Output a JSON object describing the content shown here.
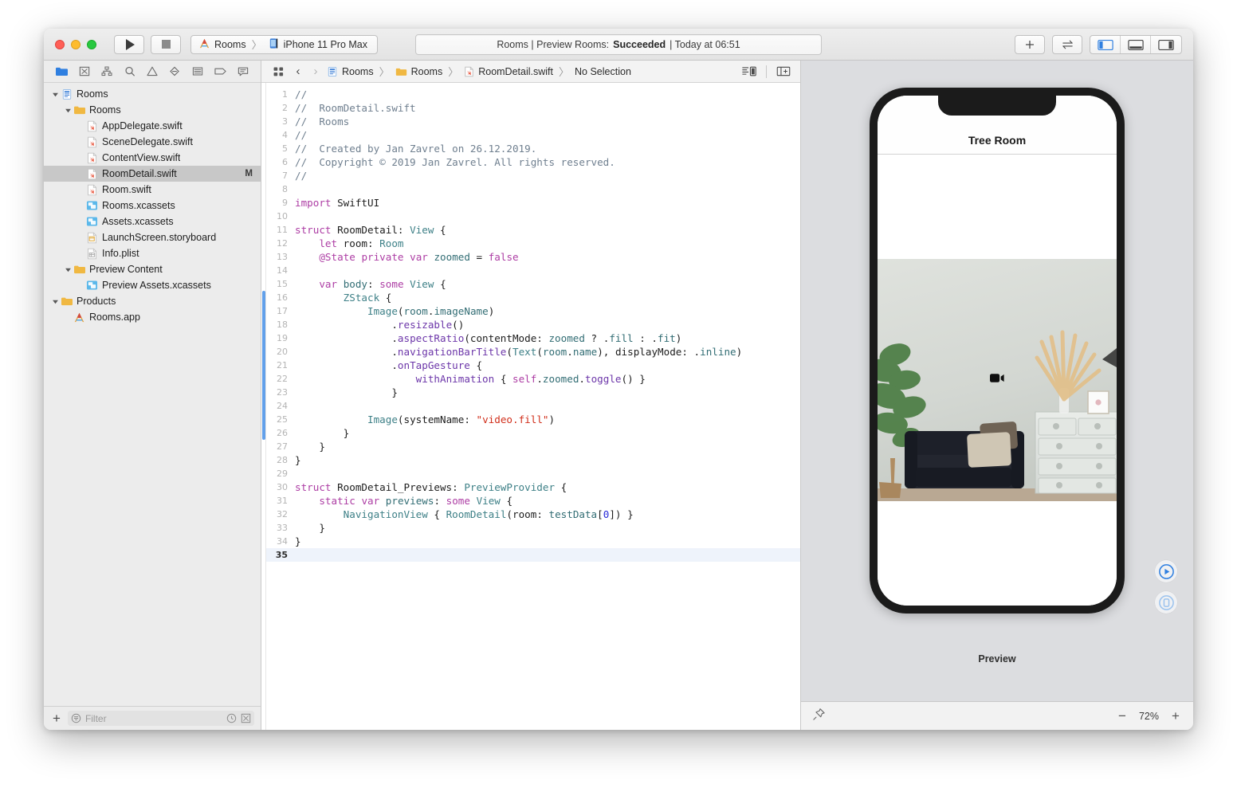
{
  "window": {
    "traffic_lights": [
      "close",
      "minimize",
      "zoom"
    ],
    "run_label": "Run",
    "stop_label": "Stop",
    "scheme": {
      "project": "Rooms",
      "separator": "〉",
      "destination": "iPhone 11 Pro Max"
    },
    "status": {
      "prefix": "Rooms | Preview Rooms:",
      "result": "Succeeded",
      "suffix": "| Today at 06:51"
    },
    "toolbar_right": [
      {
        "name": "add-button",
        "label": "+"
      },
      {
        "name": "swap-button",
        "label": "⇆"
      },
      {
        "name": "toggle-navigator-button",
        "label": "left-panel-icon"
      },
      {
        "name": "toggle-debug-area-button",
        "label": "bottom-panel-icon"
      },
      {
        "name": "toggle-inspector-button",
        "label": "right-panel-icon"
      }
    ]
  },
  "navigator": {
    "tabs": [
      {
        "name": "project-navigator-tab",
        "icon": "folder-icon",
        "active": true
      },
      {
        "name": "source-control-navigator-tab",
        "icon": "source-control-icon",
        "active": false
      },
      {
        "name": "symbol-navigator-tab",
        "icon": "hierarchy-icon",
        "active": false
      },
      {
        "name": "find-navigator-tab",
        "icon": "search-icon",
        "active": false
      },
      {
        "name": "issue-navigator-tab",
        "icon": "warning-icon",
        "active": false
      },
      {
        "name": "test-navigator-tab",
        "icon": "diamond-icon",
        "active": false
      },
      {
        "name": "debug-navigator-tab",
        "icon": "report-list-icon",
        "active": false
      },
      {
        "name": "breakpoint-navigator-tab",
        "icon": "tag-icon",
        "active": false
      },
      {
        "name": "report-navigator-tab",
        "icon": "speech-bubble-icon",
        "active": false
      }
    ],
    "tree": [
      {
        "label": "Rooms",
        "indent": 0,
        "icon": "project-icon",
        "twisty": "open",
        "selected": false,
        "badge": ""
      },
      {
        "label": "Rooms",
        "indent": 1,
        "icon": "folder-icon",
        "twisty": "open",
        "selected": false,
        "badge": ""
      },
      {
        "label": "AppDelegate.swift",
        "indent": 2,
        "icon": "swift-file-icon",
        "twisty": "none",
        "selected": false,
        "badge": ""
      },
      {
        "label": "SceneDelegate.swift",
        "indent": 2,
        "icon": "swift-file-icon",
        "twisty": "none",
        "selected": false,
        "badge": ""
      },
      {
        "label": "ContentView.swift",
        "indent": 2,
        "icon": "swift-file-icon",
        "twisty": "none",
        "selected": false,
        "badge": ""
      },
      {
        "label": "RoomDetail.swift",
        "indent": 2,
        "icon": "swift-file-icon",
        "twisty": "none",
        "selected": true,
        "badge": "M"
      },
      {
        "label": "Room.swift",
        "indent": 2,
        "icon": "swift-file-icon",
        "twisty": "none",
        "selected": false,
        "badge": ""
      },
      {
        "label": "Rooms.xcassets",
        "indent": 2,
        "icon": "assets-icon",
        "twisty": "none",
        "selected": false,
        "badge": ""
      },
      {
        "label": "Assets.xcassets",
        "indent": 2,
        "icon": "assets-icon",
        "twisty": "none",
        "selected": false,
        "badge": ""
      },
      {
        "label": "LaunchScreen.storyboard",
        "indent": 2,
        "icon": "storyboard-icon",
        "twisty": "none",
        "selected": false,
        "badge": ""
      },
      {
        "label": "Info.plist",
        "indent": 2,
        "icon": "plist-icon",
        "twisty": "none",
        "selected": false,
        "badge": ""
      },
      {
        "label": "Preview Content",
        "indent": 1,
        "icon": "folder-icon",
        "twisty": "open",
        "selected": false,
        "badge": ""
      },
      {
        "label": "Preview Assets.xcassets",
        "indent": 2,
        "icon": "assets-icon",
        "twisty": "none",
        "selected": false,
        "badge": ""
      },
      {
        "label": "Products",
        "indent": 0,
        "icon": "folder-icon",
        "twisty": "open",
        "selected": false,
        "badge": ""
      },
      {
        "label": "Rooms.app",
        "indent": 1,
        "icon": "app-icon",
        "twisty": "none",
        "selected": false,
        "badge": ""
      }
    ],
    "filter": {
      "add_label": "+",
      "placeholder": "Filter",
      "value": ""
    }
  },
  "editor": {
    "jumpbar": {
      "crumbs": [
        {
          "label": "Rooms",
          "icon": "project-icon"
        },
        {
          "label": "Rooms",
          "icon": "folder-icon"
        },
        {
          "label": "RoomDetail.swift",
          "icon": "swift-file-icon"
        },
        {
          "label": "No Selection",
          "icon": ""
        }
      ],
      "separator": "〉",
      "back_label": "‹",
      "forward_label": "›"
    },
    "current_line": 35,
    "change_bar": {
      "from_line": 16,
      "to_line": 26
    },
    "lines": [
      {
        "n": 1,
        "tokens": [
          [
            "cm",
            "//"
          ]
        ]
      },
      {
        "n": 2,
        "tokens": [
          [
            "cm",
            "//  RoomDetail.swift"
          ]
        ]
      },
      {
        "n": 3,
        "tokens": [
          [
            "cm",
            "//  Rooms"
          ]
        ]
      },
      {
        "n": 4,
        "tokens": [
          [
            "cm",
            "//"
          ]
        ]
      },
      {
        "n": 5,
        "tokens": [
          [
            "cm",
            "//  Created by Jan Zavrel on 26.12.2019."
          ]
        ]
      },
      {
        "n": 6,
        "tokens": [
          [
            "cm",
            "//  Copyright © 2019 Jan Zavrel. All rights reserved."
          ]
        ]
      },
      {
        "n": 7,
        "tokens": [
          [
            "cm",
            "//"
          ]
        ]
      },
      {
        "n": 8,
        "tokens": []
      },
      {
        "n": 9,
        "tokens": [
          [
            "kw",
            "import"
          ],
          [
            "pl",
            " SwiftUI"
          ]
        ]
      },
      {
        "n": 10,
        "tokens": []
      },
      {
        "n": 11,
        "tokens": [
          [
            "kw",
            "struct"
          ],
          [
            "pl",
            " RoomDetail: "
          ],
          [
            "ty",
            "View"
          ],
          [
            "pl",
            " {"
          ]
        ]
      },
      {
        "n": 12,
        "tokens": [
          [
            "pl",
            "    "
          ],
          [
            "kw",
            "let"
          ],
          [
            "pl",
            " room: "
          ],
          [
            "ty",
            "Room"
          ]
        ]
      },
      {
        "n": 13,
        "tokens": [
          [
            "pl",
            "    "
          ],
          [
            "kw",
            "@State"
          ],
          [
            "pl",
            " "
          ],
          [
            "kw",
            "private"
          ],
          [
            "pl",
            " "
          ],
          [
            "kw",
            "var"
          ],
          [
            "pl",
            " "
          ],
          [
            "pr",
            "zoomed"
          ],
          [
            "pl",
            " = "
          ],
          [
            "kw",
            "false"
          ]
        ]
      },
      {
        "n": 14,
        "tokens": []
      },
      {
        "n": 15,
        "tokens": [
          [
            "pl",
            "    "
          ],
          [
            "kw",
            "var"
          ],
          [
            "pl",
            " "
          ],
          [
            "pr",
            "body"
          ],
          [
            "pl",
            ": "
          ],
          [
            "kw",
            "some"
          ],
          [
            "pl",
            " "
          ],
          [
            "ty",
            "View"
          ],
          [
            "pl",
            " {"
          ]
        ]
      },
      {
        "n": 16,
        "tokens": [
          [
            "pl",
            "        "
          ],
          [
            "ty",
            "ZStack"
          ],
          [
            "pl",
            " {"
          ]
        ]
      },
      {
        "n": 17,
        "tokens": [
          [
            "pl",
            "            "
          ],
          [
            "ty",
            "Image"
          ],
          [
            "pl",
            "("
          ],
          [
            "pr",
            "room"
          ],
          [
            "pl",
            "."
          ],
          [
            "pr",
            "imageName"
          ],
          [
            "pl",
            ")"
          ]
        ]
      },
      {
        "n": 18,
        "tokens": [
          [
            "pl",
            "                ."
          ],
          [
            "fn",
            "resizable"
          ],
          [
            "pl",
            "()"
          ]
        ]
      },
      {
        "n": 19,
        "tokens": [
          [
            "pl",
            "                ."
          ],
          [
            "fn",
            "aspectRatio"
          ],
          [
            "pl",
            "(contentMode: "
          ],
          [
            "pr",
            "zoomed"
          ],
          [
            "pl",
            " ? ."
          ],
          [
            "pr",
            "fill"
          ],
          [
            "pl",
            " : ."
          ],
          [
            "pr",
            "fit"
          ],
          [
            "pl",
            ")"
          ]
        ]
      },
      {
        "n": 20,
        "tokens": [
          [
            "pl",
            "                ."
          ],
          [
            "fn",
            "navigationBarTitle"
          ],
          [
            "pl",
            "("
          ],
          [
            "ty",
            "Text"
          ],
          [
            "pl",
            "("
          ],
          [
            "pr",
            "room"
          ],
          [
            "pl",
            "."
          ],
          [
            "pr",
            "name"
          ],
          [
            "pl",
            "), displayMode: ."
          ],
          [
            "pr",
            "inline"
          ],
          [
            "pl",
            ")"
          ]
        ]
      },
      {
        "n": 21,
        "tokens": [
          [
            "pl",
            "                ."
          ],
          [
            "fn",
            "onTapGesture"
          ],
          [
            "pl",
            " {"
          ]
        ]
      },
      {
        "n": 22,
        "tokens": [
          [
            "pl",
            "                    "
          ],
          [
            "fn",
            "withAnimation"
          ],
          [
            "pl",
            " { "
          ],
          [
            "kw",
            "self"
          ],
          [
            "pl",
            "."
          ],
          [
            "pr",
            "zoomed"
          ],
          [
            "pl",
            "."
          ],
          [
            "fn",
            "toggle"
          ],
          [
            "pl",
            "() }"
          ]
        ]
      },
      {
        "n": 23,
        "tokens": [
          [
            "pl",
            "                }"
          ]
        ]
      },
      {
        "n": 24,
        "tokens": []
      },
      {
        "n": 25,
        "tokens": [
          [
            "pl",
            "            "
          ],
          [
            "ty",
            "Image"
          ],
          [
            "pl",
            "(systemName: "
          ],
          [
            "st",
            "\"video.fill\""
          ],
          [
            "pl",
            ")"
          ]
        ]
      },
      {
        "n": 26,
        "tokens": [
          [
            "pl",
            "        }"
          ]
        ]
      },
      {
        "n": 27,
        "tokens": [
          [
            "pl",
            "    }"
          ]
        ]
      },
      {
        "n": 28,
        "tokens": [
          [
            "pl",
            "}"
          ]
        ]
      },
      {
        "n": 29,
        "tokens": []
      },
      {
        "n": 30,
        "tokens": [
          [
            "kw",
            "struct"
          ],
          [
            "pl",
            " RoomDetail_Previews: "
          ],
          [
            "ty",
            "PreviewProvider"
          ],
          [
            "pl",
            " {"
          ]
        ]
      },
      {
        "n": 31,
        "tokens": [
          [
            "pl",
            "    "
          ],
          [
            "kw",
            "static"
          ],
          [
            "pl",
            " "
          ],
          [
            "kw",
            "var"
          ],
          [
            "pl",
            " "
          ],
          [
            "pr",
            "previews"
          ],
          [
            "pl",
            ": "
          ],
          [
            "kw",
            "some"
          ],
          [
            "pl",
            " "
          ],
          [
            "ty",
            "View"
          ],
          [
            "pl",
            " {"
          ]
        ]
      },
      {
        "n": 32,
        "tokens": [
          [
            "pl",
            "        "
          ],
          [
            "ty",
            "NavigationView"
          ],
          [
            "pl",
            " { "
          ],
          [
            "ty",
            "RoomDetail"
          ],
          [
            "pl",
            "(room: "
          ],
          [
            "pr",
            "testData"
          ],
          [
            "pl",
            "["
          ],
          [
            "nu",
            "0"
          ],
          [
            "pl",
            "]) }"
          ]
        ]
      },
      {
        "n": 33,
        "tokens": [
          [
            "pl",
            "    }"
          ]
        ]
      },
      {
        "n": 34,
        "tokens": [
          [
            "pl",
            "}"
          ]
        ]
      },
      {
        "n": 35,
        "tokens": []
      }
    ],
    "right_tools": [
      {
        "name": "editor-options-button",
        "icon": "editor-options-icon"
      },
      {
        "name": "add-editor-button",
        "icon": "add-editor-icon"
      }
    ]
  },
  "canvas": {
    "device_name": "iPhone 11 Pro Max",
    "preview_title": "Tree Room",
    "preview_label": "Preview",
    "video_icon": "video-fill-icon",
    "controls": [
      {
        "name": "live-preview-button",
        "icon": "play-circle-icon"
      },
      {
        "name": "preview-on-device-button",
        "icon": "device-circle-icon"
      }
    ],
    "pin_label": "pin-icon",
    "zoom": {
      "out_label": "−",
      "value": "72%",
      "in_label": "+"
    }
  },
  "colors": {
    "accent": "#3b82f6",
    "selection": "#c8c8c8",
    "change_bar": "#62a0ea",
    "current_line": "#eef3fb",
    "canvas_bg": "#dcdde0"
  }
}
